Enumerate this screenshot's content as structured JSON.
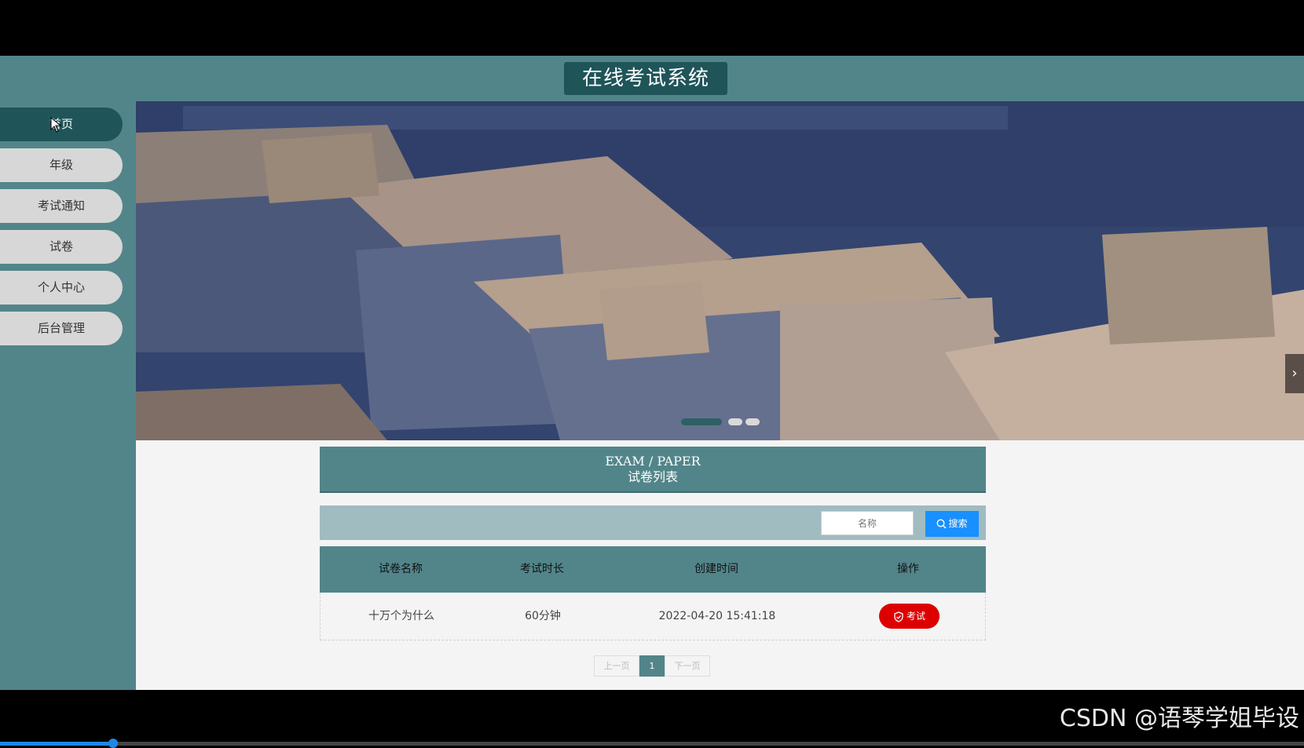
{
  "header": {
    "title": "在线考试系统"
  },
  "sidebar": {
    "items": [
      {
        "label": "首页",
        "active": true
      },
      {
        "label": "年级",
        "active": false
      },
      {
        "label": "考试通知",
        "active": false
      },
      {
        "label": "试卷",
        "active": false
      },
      {
        "label": "个人中心",
        "active": false
      },
      {
        "label": "后台管理",
        "active": false
      }
    ]
  },
  "banner": {
    "slides": 3,
    "active_slide": 1,
    "next_icon": "chevron-right-icon"
  },
  "section": {
    "title_en": "EXAM / PAPER",
    "title_cn": "试卷列表"
  },
  "search": {
    "placeholder": "名称",
    "button_label": "搜索",
    "icon": "search-icon"
  },
  "table": {
    "columns": [
      "试卷名称",
      "考试时长",
      "创建时间",
      "操作"
    ],
    "rows": [
      {
        "name": "十万个为什么",
        "duration": "60分钟",
        "created": "2022-04-20 15:41:18",
        "action": "考试"
      }
    ],
    "action_icon": "shield-check-icon"
  },
  "pagination": {
    "prev": "上一页",
    "current": "1",
    "next": "下一页"
  },
  "watermark": "CSDN @语琴学姐毕设",
  "video_progress": {
    "fraction": 0.087
  },
  "colors": {
    "teal": "#52858a",
    "dark_teal": "#1f5559",
    "search_blue": "#1890ff",
    "exam_red": "#dd0000"
  }
}
